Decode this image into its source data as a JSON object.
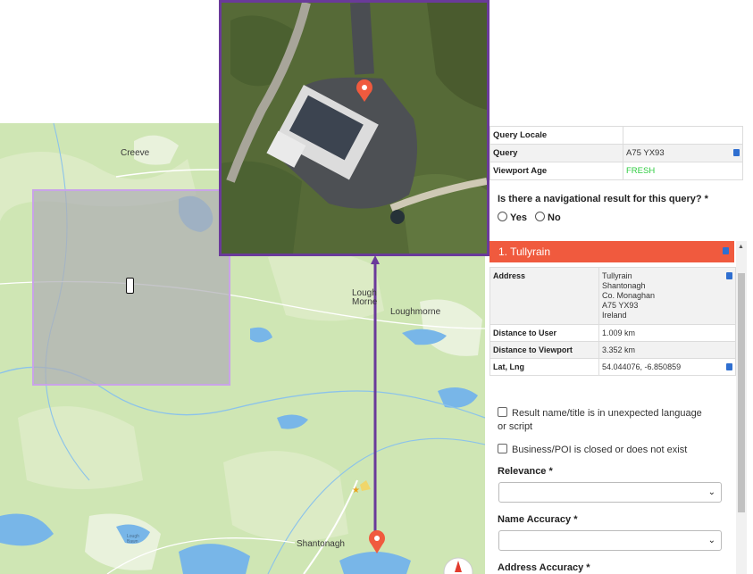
{
  "map": {
    "labels": {
      "creeve": "Creeve",
      "lough_morne": "Lough\nMorne",
      "loughmorne": "Loughmorne",
      "shantonagh": "Shantonagh",
      "lough_small": "Lough\nBawn"
    }
  },
  "query_table": {
    "locale_label": "Query Locale",
    "locale_value": "",
    "query_label": "Query",
    "query_value": "A75 YX93",
    "viewport_age_label": "Viewport Age",
    "viewport_age_value": "FRESH",
    "viewport_age_color": "#2ecc40"
  },
  "question": {
    "text": "Is there a navigational result for this query? *",
    "yes": "Yes",
    "no": "No"
  },
  "result": {
    "header": "1. Tullyrain",
    "header_color": "#f05a3e",
    "address_label": "Address",
    "address_lines": [
      "Tullyrain",
      "Shantonagh",
      "Co. Monaghan",
      "A75 YX93",
      "Ireland"
    ],
    "distance_user_label": "Distance to User",
    "distance_user_value": "1.009 km",
    "distance_viewport_label": "Distance to Viewport",
    "distance_viewport_value": "3.352 km",
    "latlng_label": "Lat, Lng",
    "latlng_value": "54.044076, -6.850859"
  },
  "checks": {
    "unexpected_language": "Result name/title is in unexpected language or script",
    "closed": "Business/POI is closed or does not exist"
  },
  "form": {
    "relevance_label": "Relevance *",
    "name_accuracy_label": "Name Accuracy *",
    "address_accuracy_label": "Address Accuracy *"
  },
  "icons": {
    "copy": "clipboard-icon",
    "pin": "map-pin-icon",
    "phone": "phone-icon",
    "compass": "compass-icon",
    "star": "star-icon"
  }
}
